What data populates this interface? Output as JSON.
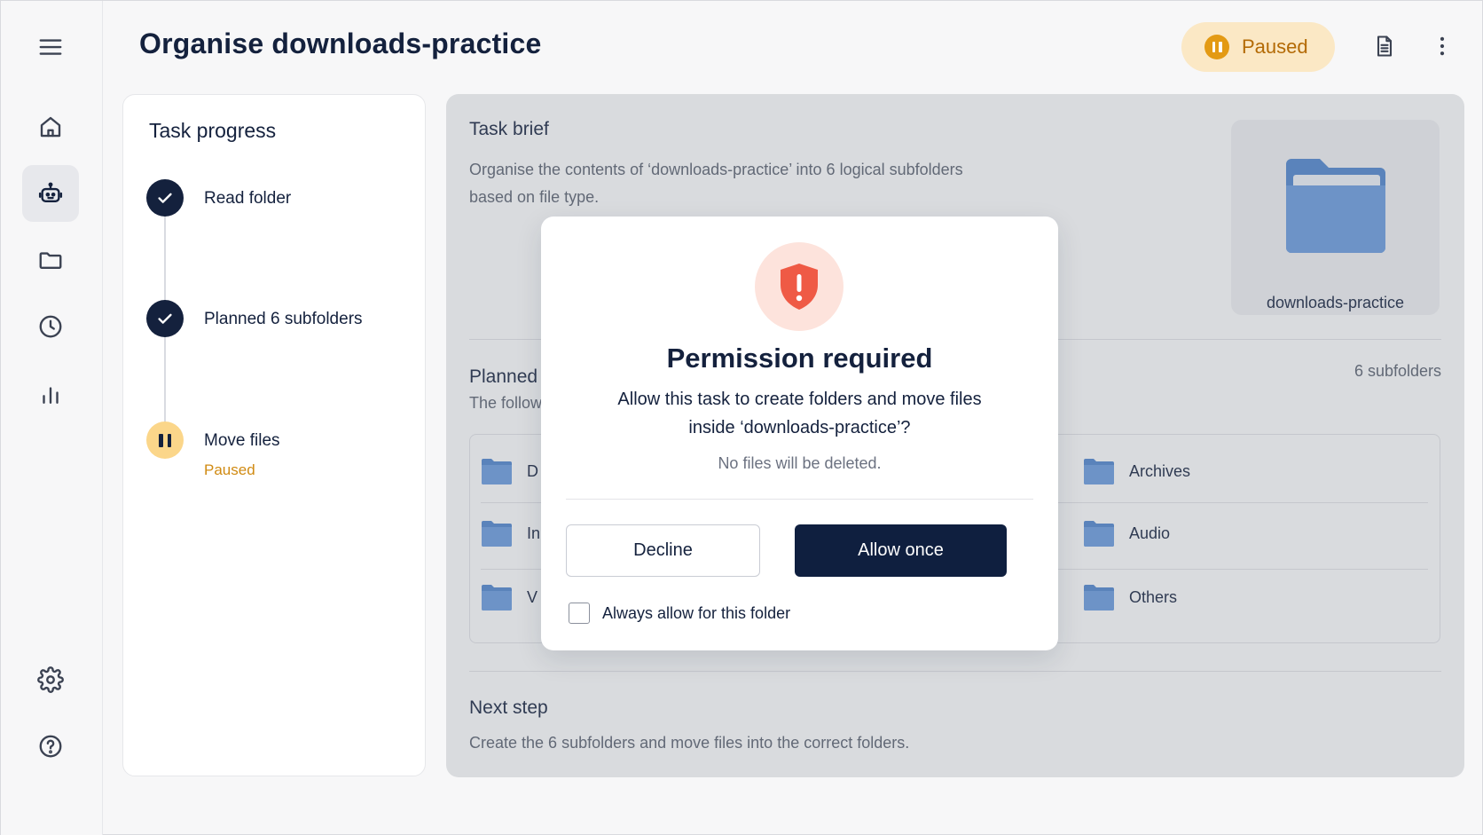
{
  "header": {
    "title": "Organise downloads-practice",
    "status": "Paused",
    "icons": [
      "menu-icon",
      "document-icon",
      "more-vertical-icon"
    ]
  },
  "sidebar": {
    "items": [
      {
        "icon": "home-icon",
        "active": false
      },
      {
        "icon": "robot-icon",
        "active": true
      },
      {
        "icon": "folder-icon",
        "active": false
      },
      {
        "icon": "clock-icon",
        "active": false
      },
      {
        "icon": "bar-chart-icon",
        "active": false
      },
      {
        "icon": "gear-icon",
        "active": false
      },
      {
        "icon": "help-icon",
        "active": false
      }
    ]
  },
  "progress": {
    "title": "Task progress",
    "steps": [
      {
        "label": "Read folder",
        "state": "done"
      },
      {
        "label": "Planned 6 subfolders",
        "state": "done"
      },
      {
        "label": "Move files",
        "state": "paused",
        "sub": "Paused"
      }
    ]
  },
  "brief": {
    "title": "Task brief",
    "text_line1": "Organise the contents of ‘downloads-practice’ into 6 logical subfolders",
    "text_line2": "based on file type.",
    "folder_name": "downloads-practice"
  },
  "planned": {
    "title": "Planned",
    "subtitle": "The follow",
    "count": "6 subfolders",
    "left_items": [
      "D",
      "In",
      "V"
    ],
    "right_items": [
      "Archives",
      "Audio",
      "Others"
    ]
  },
  "next_step": {
    "title": "Next step",
    "text": "Create the 6 subfolders and move files into the correct folders."
  },
  "modal": {
    "title": "Permission required",
    "line1": "Allow this task to create folders and move files",
    "line2": "inside ‘downloads-practice’?",
    "note": "No files will be deleted.",
    "decline_label": "Decline",
    "allow_label": "Allow once",
    "checkbox_label": "Always allow for this folder",
    "checkbox_checked": false
  },
  "colors": {
    "navy": "#14213d",
    "accent_orange": "#e39a14",
    "paused_pill_bg": "#fbe8c5",
    "folder_blue": "#5b8ed6",
    "shield_red": "#ef5a45"
  }
}
